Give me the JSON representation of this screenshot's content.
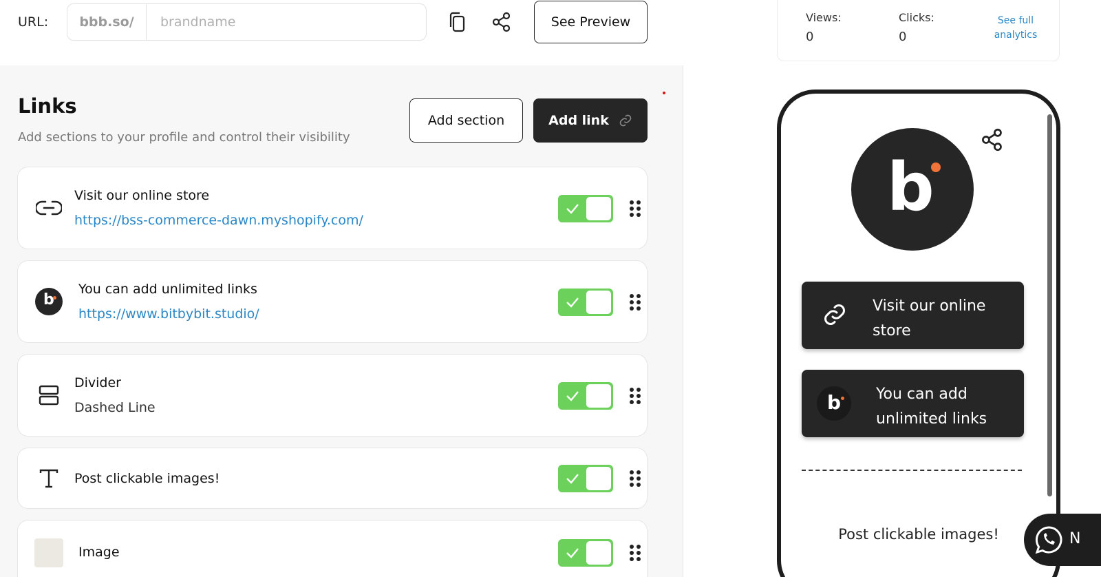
{
  "header": {
    "url_label": "URL:",
    "url_prefix": "bbb.so/",
    "url_placeholder": "brandname",
    "preview_label": "See Preview"
  },
  "links_section": {
    "title": "Links",
    "subtitle": "Add sections to your profile and control their visibility",
    "add_section_label": "Add section",
    "add_link_label": "Add link"
  },
  "items": [
    {
      "title": "Visit our online store",
      "subtitle": "https://bss-commerce-dawn.myshopify.com/",
      "icon": "link-icon",
      "enabled": true
    },
    {
      "title": "You can add unlimited links",
      "subtitle": "https://www.bitbybit.studio/",
      "icon": "brand-logo",
      "enabled": true
    },
    {
      "title": "Divider",
      "subtitle": "Dashed Line",
      "icon": "divider-icon",
      "enabled": true
    },
    {
      "title": "Post clickable images!",
      "subtitle": "",
      "icon": "text-icon",
      "enabled": true
    },
    {
      "title": "Image",
      "subtitle": "",
      "icon": "image-thumbnail",
      "enabled": true
    }
  ],
  "stats": {
    "views_label": "Views:",
    "views_value": "0",
    "clicks_label": "Clicks:",
    "clicks_value": "0",
    "analytics_link": "See full analytics"
  },
  "preview": {
    "logo_letter": "b",
    "buttons": [
      {
        "label": "Visit our online store"
      },
      {
        "label": "You can add unlimited links"
      }
    ],
    "text_block": "Post clickable images!",
    "logo_letter_small": "b"
  },
  "chat_widget": {
    "label": "N"
  },
  "colors": {
    "accent_dark": "#262626",
    "toggle_on": "#6bd15a",
    "link_blue": "#2b86c5",
    "brand_orange": "#f2733a"
  }
}
